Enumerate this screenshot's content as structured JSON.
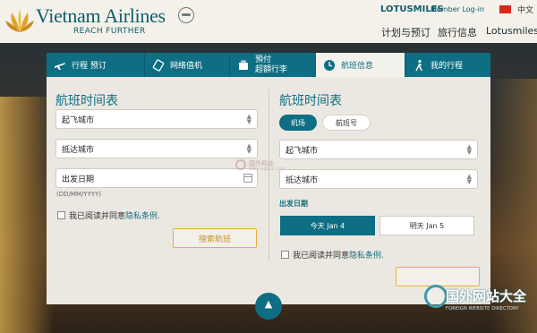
{
  "header": {
    "brand": "Vietnam Airlines",
    "tagline": "REACH FURTHER",
    "lotusmiles_label": "LOTUSMILES",
    "login_label": "Member Log-in",
    "language": "中文",
    "nav": [
      "计划与预订",
      "旅行信息",
      "Lotusmiles"
    ]
  },
  "tabs": [
    {
      "label": "行程 预订",
      "icon": "plane-icon"
    },
    {
      "label": "网络值机",
      "icon": "ticket-icon"
    },
    {
      "label_line1": "預付",
      "label_line2": "超額行李",
      "icon": "luggage-icon"
    },
    {
      "label": "航班信息",
      "icon": "clock-icon",
      "active": true
    },
    {
      "label": "我的行程",
      "icon": "walking-person-icon"
    }
  ],
  "left": {
    "title": "航班时间表",
    "origin_value": "起飞城市",
    "destination_value": "抵达城市",
    "date_value": "出发日期",
    "date_hint": "(DD/MM/YYYY)",
    "agree_text": "我已阅读并同意",
    "agree_link": "隐私条例.",
    "search_button": "搜索航班"
  },
  "right": {
    "title": "航班时间表",
    "toggle_airport": "机场",
    "toggle_flight_no": "航班号",
    "origin_value": "起飞城市",
    "destination_value": "抵达城市",
    "date_label": "出发日期",
    "today_label": "今天 Jan 4",
    "tomorrow_label": "明天 Jan 5",
    "agree_text": "我已阅读并同意",
    "agree_link": "隐私条例."
  },
  "watermark": {
    "text": "国外网站大全",
    "sub": "FOREIGN WEBSITE DIRECTORY",
    "center_text": "国外网站",
    "center_sub": "www.egouz.com"
  },
  "colors": {
    "accent": "#0e6e83",
    "gold": "#e3b13b",
    "header_bg": "#f4f1ea",
    "panel_bg": "#ebe8e2"
  }
}
